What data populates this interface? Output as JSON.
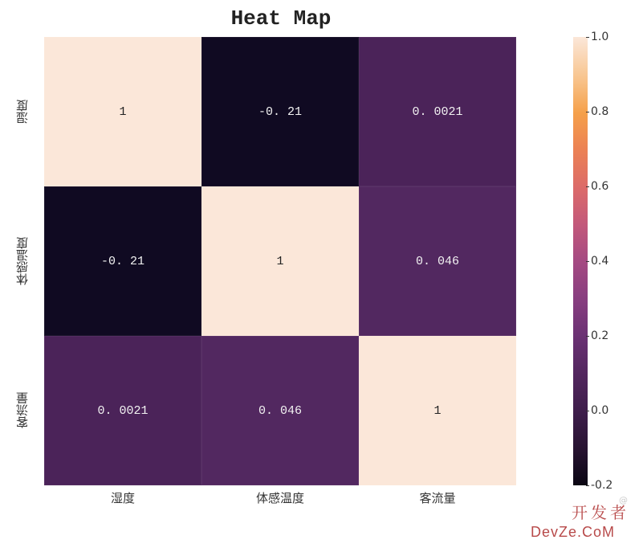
{
  "chart_data": {
    "type": "heatmap",
    "title": "Heat Map",
    "xlabels": [
      "湿度",
      "体感温度",
      "客流量"
    ],
    "ylabels": [
      "湿度",
      "体感温度",
      "客流量"
    ],
    "values": [
      [
        1,
        -0.21,
        0.0021
      ],
      [
        -0.21,
        1,
        0.046
      ],
      [
        0.0021,
        0.046,
        1
      ]
    ],
    "value_labels": [
      [
        "1",
        "-0. 21",
        "0. 0021"
      ],
      [
        "-0. 21",
        "1",
        "0. 046"
      ],
      [
        "0. 0021",
        "0. 046",
        "1"
      ]
    ],
    "cell_bg": [
      [
        "#fbe7d9",
        "#100a22",
        "#4b2359"
      ],
      [
        "#100a22",
        "#fbe7d9",
        "#522860"
      ],
      [
        "#4b2359",
        "#522860",
        "#fbe7d9"
      ]
    ],
    "cell_fg": [
      [
        "#222222",
        "#f2f2f2",
        "#f2f2f2"
      ],
      [
        "#f2f2f2",
        "#222222",
        "#f2f2f2"
      ],
      [
        "#f2f2f2",
        "#f2f2f2",
        "#222222"
      ]
    ],
    "colorbar": {
      "ticks": [
        "-0.2",
        "0.0",
        "0.2",
        "0.4",
        "0.6",
        "0.8",
        "1.0"
      ],
      "tick_positions_pct": [
        100,
        83.33,
        66.67,
        50,
        33.33,
        16.67,
        0
      ],
      "range": [
        -0.2,
        1.0
      ]
    }
  },
  "watermark": {
    "cn": "开发者",
    "en": "DevZe.CoM",
    "sub": "@"
  }
}
